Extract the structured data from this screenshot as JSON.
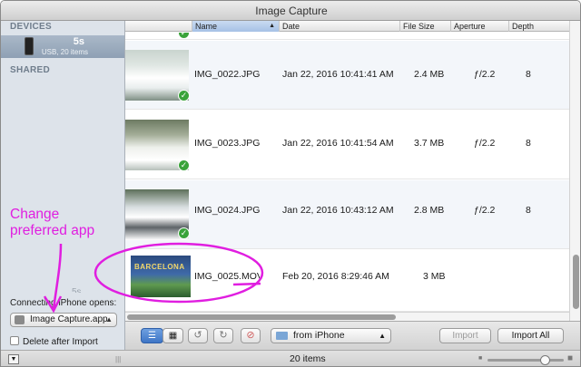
{
  "window": {
    "title": "Image Capture"
  },
  "sidebar": {
    "devices_header": "DEVICES",
    "shared_header": "SHARED",
    "device": {
      "name": "5s",
      "subtitle": "USB, 20 items"
    },
    "faint_label": "5s",
    "connecting_label": "Connecting iPhone opens:",
    "app_select_value": "Image Capture.app",
    "delete_after_import": {
      "label": "Delete after Import",
      "checked": false
    }
  },
  "table": {
    "columns": [
      "Name",
      "Date",
      "File Size",
      "Aperture",
      "Depth"
    ],
    "sorted_column": "Name",
    "rows": [
      {
        "name": "IMG_0022.JPG",
        "date": "Jan 22, 2016 10:41:41 AM",
        "size": "2.4 MB",
        "aperture": "ƒ/2.2",
        "depth": "8",
        "imported": true
      },
      {
        "name": "IMG_0023.JPG",
        "date": "Jan 22, 2016 10:41:54 AM",
        "size": "3.7 MB",
        "aperture": "ƒ/2.2",
        "depth": "8",
        "imported": true
      },
      {
        "name": "IMG_0024.JPG",
        "date": "Jan 22, 2016 10:43:12 AM",
        "size": "2.8 MB",
        "aperture": "ƒ/2.2",
        "depth": "8",
        "imported": true
      },
      {
        "name": "IMG_0025.MOV",
        "date": "Feb 20, 2016 8:29:46 AM",
        "size": "3 MB",
        "aperture": "",
        "depth": "",
        "imported": false,
        "thumb_text": "BARCELONA"
      }
    ]
  },
  "toolbar": {
    "import_to": "from iPhone",
    "import_label": "Import",
    "import_all_label": "Import All"
  },
  "statusbar": {
    "count": "20 items",
    "thumbnail_size": 0.75
  },
  "annotation": {
    "line1": "Change",
    "line2": "preferred app",
    "color": "#e01ee0"
  }
}
